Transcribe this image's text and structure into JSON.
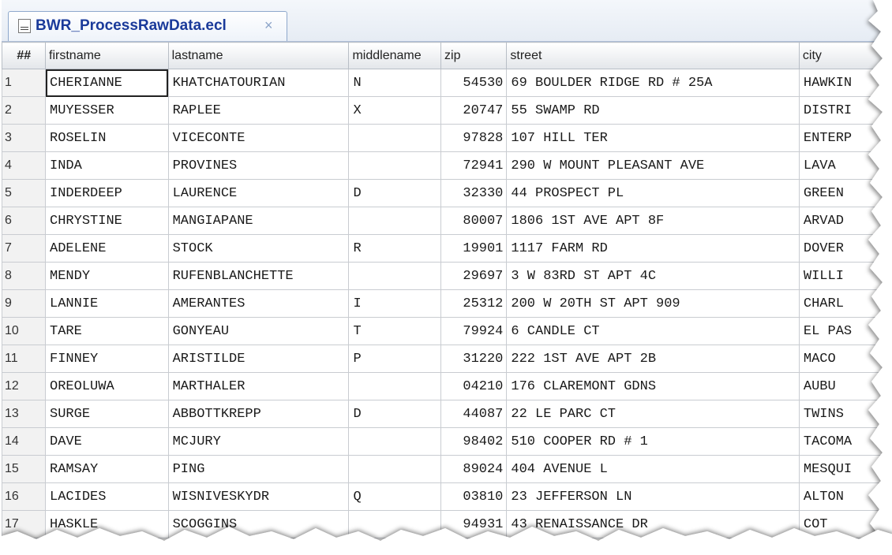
{
  "tab": {
    "title": "BWR_ProcessRawData.ecl",
    "close_glyph": "×",
    "icon": "ecl-file-icon"
  },
  "grid": {
    "columns": [
      "##",
      "firstname",
      "lastname",
      "middlename",
      "zip",
      "street",
      "city"
    ],
    "rows": [
      {
        "num": "1",
        "firstname": "CHERIANNE",
        "lastname": "KHATCHATOURIAN",
        "middlename": "N",
        "zip": "54530",
        "street": "69 BOULDER RIDGE RD # 25A",
        "city": "HAWKIN"
      },
      {
        "num": "2",
        "firstname": "MUYESSER",
        "lastname": "RAPLEE",
        "middlename": "X",
        "zip": "20747",
        "street": "55 SWAMP RD",
        "city": "DISTRI"
      },
      {
        "num": "3",
        "firstname": "ROSELIN",
        "lastname": "VICECONTE",
        "middlename": "",
        "zip": "97828",
        "street": "107 HILL TER",
        "city": "ENTERP"
      },
      {
        "num": "4",
        "firstname": "INDA",
        "lastname": "PROVINES",
        "middlename": "",
        "zip": "72941",
        "street": "290 W MOUNT PLEASANT AVE",
        "city": "LAVA"
      },
      {
        "num": "5",
        "firstname": "INDERDEEP",
        "lastname": "LAURENCE",
        "middlename": "D",
        "zip": "32330",
        "street": "44 PROSPECT PL",
        "city": "GREEN"
      },
      {
        "num": "6",
        "firstname": "CHRYSTINE",
        "lastname": "MANGIAPANE",
        "middlename": "",
        "zip": "80007",
        "street": "1806 1ST AVE APT 8F",
        "city": "ARVAD"
      },
      {
        "num": "7",
        "firstname": "ADELENE",
        "lastname": "STOCK",
        "middlename": "R",
        "zip": "19901",
        "street": "1117 FARM RD",
        "city": "DOVER"
      },
      {
        "num": "8",
        "firstname": "MENDY",
        "lastname": "RUFENBLANCHETTE",
        "middlename": "",
        "zip": "29697",
        "street": "3 W 83RD ST APT 4C",
        "city": "WILLI"
      },
      {
        "num": "9",
        "firstname": "LANNIE",
        "lastname": "AMERANTES",
        "middlename": "I",
        "zip": "25312",
        "street": "200 W 20TH ST APT 909",
        "city": "CHARL"
      },
      {
        "num": "10",
        "firstname": "TARE",
        "lastname": "GONYEAU",
        "middlename": "T",
        "zip": "79924",
        "street": "6 CANDLE CT",
        "city": "EL PAS"
      },
      {
        "num": "11",
        "firstname": "FINNEY",
        "lastname": "ARISTILDE",
        "middlename": "P",
        "zip": "31220",
        "street": "222 1ST AVE APT 2B",
        "city": "MACO"
      },
      {
        "num": "12",
        "firstname": "OREOLUWA",
        "lastname": "MARTHALER",
        "middlename": "",
        "zip": "04210",
        "street": "176 CLAREMONT GDNS",
        "city": "AUBU"
      },
      {
        "num": "13",
        "firstname": "SURGE",
        "lastname": "ABBOTTKREPP",
        "middlename": "D",
        "zip": "44087",
        "street": "22 LE PARC CT",
        "city": "TWINS"
      },
      {
        "num": "14",
        "firstname": "DAVE",
        "lastname": "MCJURY",
        "middlename": "",
        "zip": "98402",
        "street": "510 COOPER RD # 1",
        "city": "TACOMA"
      },
      {
        "num": "15",
        "firstname": "RAMSAY",
        "lastname": "PING",
        "middlename": "",
        "zip": "89024",
        "street": "404 AVENUE L",
        "city": "MESQUI"
      },
      {
        "num": "16",
        "firstname": "LACIDES",
        "lastname": "WISNIVESKYDR",
        "middlename": "Q",
        "zip": "03810",
        "street": "23 JEFFERSON LN",
        "city": "ALTON"
      },
      {
        "num": "17",
        "firstname": "HASKLE",
        "lastname": "SCOGGINS",
        "middlename": "",
        "zip": "94931",
        "street": "43 RENAISSANCE DR",
        "city": "COT"
      }
    ]
  },
  "colors": {
    "tab_title": "#1a3a9a",
    "tab_close": "#8ba3c8",
    "grid_border": "#c9ccd1",
    "header_bg": "#e3e6ea"
  }
}
